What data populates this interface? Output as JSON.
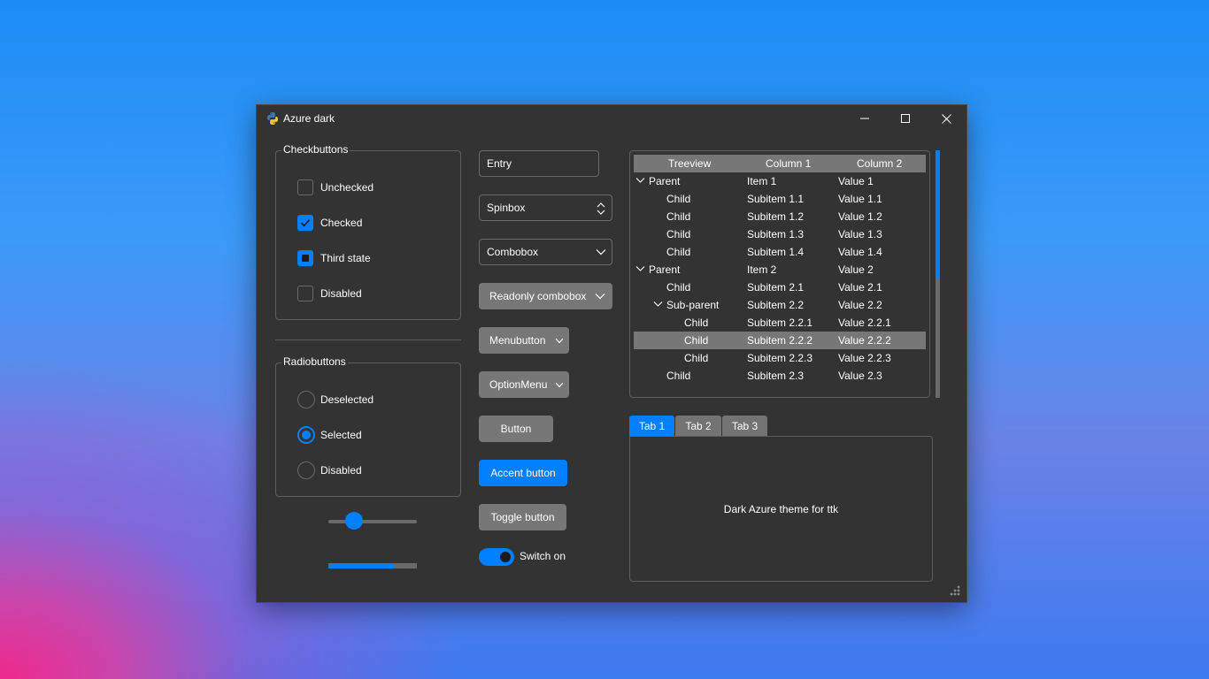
{
  "window": {
    "title": "Azure dark"
  },
  "accent_color": "#007fff",
  "checkbuttons": {
    "title": "Checkbuttons",
    "items": [
      {
        "label": "Unchecked",
        "state": "unchecked"
      },
      {
        "label": "Checked",
        "state": "checked"
      },
      {
        "label": "Third state",
        "state": "indeterminate"
      },
      {
        "label": "Disabled",
        "state": "disabled"
      }
    ]
  },
  "radiobuttons": {
    "title": "Radiobuttons",
    "items": [
      {
        "label": "Deselected",
        "state": "deselected"
      },
      {
        "label": "Selected",
        "state": "selected"
      },
      {
        "label": "Disabled",
        "state": "disabled"
      }
    ]
  },
  "widgets": {
    "entry": "Entry",
    "spinbox": "Spinbox",
    "combobox": "Combobox",
    "readonly_combobox": "Readonly combobox",
    "menubutton": "Menubutton",
    "optionmenu": "OptionMenu",
    "button": "Button",
    "accent_button": "Accent button",
    "toggle_button": "Toggle button",
    "switch_label": "Switch on",
    "switch_on": true
  },
  "scale": {
    "value_fraction": 0.3
  },
  "progressbar": {
    "value_fraction": 0.75
  },
  "treeview": {
    "headers": [
      "Treeview",
      "Column 1",
      "Column 2"
    ],
    "rows": [
      {
        "name": "Parent",
        "col1": "Item 1",
        "col2": "Value 1",
        "expander": true
      },
      {
        "name": "Child",
        "col1": "Subitem 1.1",
        "col2": "Value 1.1"
      },
      {
        "name": "Child",
        "col1": "Subitem 1.2",
        "col2": "Value 1.2"
      },
      {
        "name": "Child",
        "col1": "Subitem 1.3",
        "col2": "Value 1.3"
      },
      {
        "name": "Child",
        "col1": "Subitem 1.4",
        "col2": "Value 1.4"
      },
      {
        "name": "Parent",
        "col1": "Item 2",
        "col2": "Value 2",
        "expander": true
      },
      {
        "name": "Child",
        "col1": "Subitem 2.1",
        "col2": "Value 2.1"
      },
      {
        "name": "Sub-parent",
        "col1": "Subitem 2.2",
        "col2": "Value 2.2",
        "expander": true
      },
      {
        "name": "Child",
        "col1": "Subitem 2.2.1",
        "col2": "Value 2.2.1"
      },
      {
        "name": "Child",
        "col1": "Subitem 2.2.2",
        "col2": "Value 2.2.2",
        "selected": true
      },
      {
        "name": "Child",
        "col1": "Subitem 2.2.3",
        "col2": "Value 2.2.3"
      },
      {
        "name": "Child",
        "col1": "Subitem 2.3",
        "col2": "Value 2.3"
      }
    ]
  },
  "notebook": {
    "tabs": [
      "Tab 1",
      "Tab 2",
      "Tab 3"
    ],
    "active_tab": "Tab 1",
    "content": "Dark Azure theme for ttk"
  }
}
